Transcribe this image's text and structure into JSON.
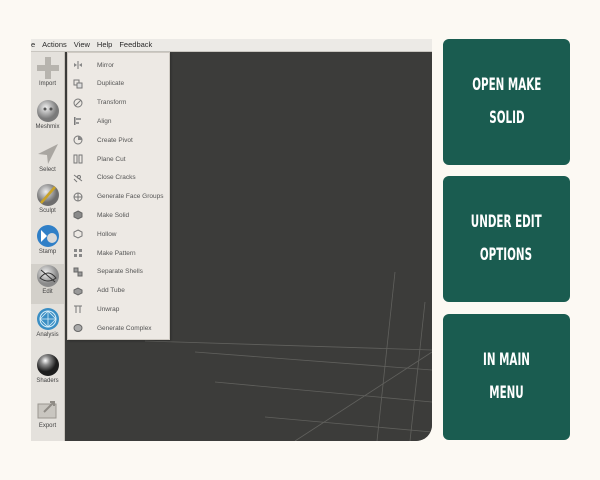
{
  "menubar": [
    "e",
    "Actions",
    "View",
    "Help",
    "Feedback"
  ],
  "toolbar": [
    {
      "label": "Import",
      "icon": "import-icon"
    },
    {
      "label": "Meshmix",
      "icon": "meshmix-icon"
    },
    {
      "label": "Select",
      "icon": "select-icon"
    },
    {
      "label": "Sculpt",
      "icon": "sculpt-icon"
    },
    {
      "label": "Stamp",
      "icon": "stamp-icon"
    },
    {
      "label": "Edit",
      "icon": "edit-icon"
    },
    {
      "label": "Analysis",
      "icon": "analysis-icon"
    },
    {
      "label": "Shaders",
      "icon": "shaders-icon"
    },
    {
      "label": "Export",
      "icon": "export-icon"
    }
  ],
  "edit_menu": [
    {
      "label": "Mirror",
      "icon": "mirror-icon"
    },
    {
      "label": "Duplicate",
      "icon": "duplicate-icon"
    },
    {
      "label": "Transform",
      "icon": "transform-icon"
    },
    {
      "label": "Align",
      "icon": "align-icon"
    },
    {
      "label": "Create Pivot",
      "icon": "pivot-icon"
    },
    {
      "label": "Plane Cut",
      "icon": "plane-cut-icon"
    },
    {
      "label": "Close Cracks",
      "icon": "close-cracks-icon"
    },
    {
      "label": "Generate Face Groups",
      "icon": "face-groups-icon"
    },
    {
      "label": "Make Solid",
      "icon": "make-solid-icon"
    },
    {
      "label": "Hollow",
      "icon": "hollow-icon"
    },
    {
      "label": "Make Pattern",
      "icon": "pattern-icon"
    },
    {
      "label": "Separate Shells",
      "icon": "separate-shells-icon"
    },
    {
      "label": "Add Tube",
      "icon": "tube-icon"
    },
    {
      "label": "Unwrap",
      "icon": "unwrap-icon"
    },
    {
      "label": "Generate Complex",
      "icon": "complex-icon"
    }
  ],
  "cards": [
    [
      "OPEN MAKE",
      "SOLID"
    ],
    [
      "UNDER EDIT",
      "OPTIONS"
    ],
    [
      "IN MAIN MENU"
    ]
  ],
  "colors": {
    "card_bg": "#1a5c50",
    "page_bg": "#fcf9f3",
    "viewport_bg": "#3c3c3a"
  }
}
